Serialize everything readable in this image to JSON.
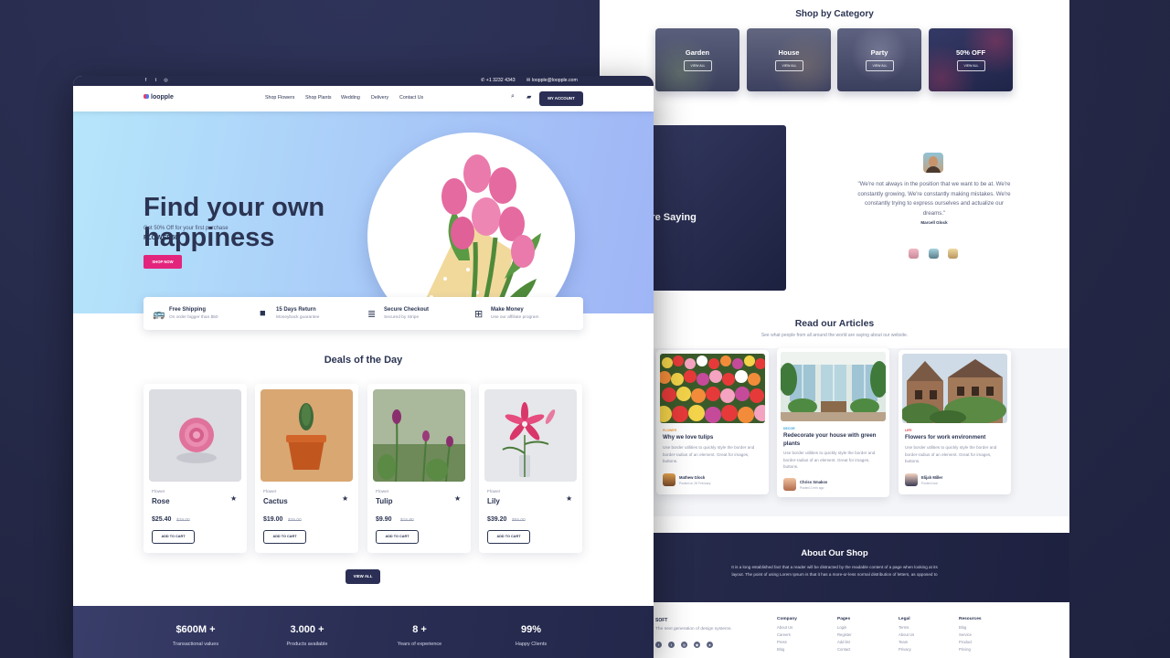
{
  "main": {
    "topbar": {
      "phone": "+1 3232 4343",
      "email": "loopple@loopple.com"
    },
    "nav": {
      "brand": "loopple",
      "links": [
        "Shop Flowers",
        "Shop Plants",
        "Wedding",
        "Delivery",
        "Contact Us"
      ],
      "account_label": "MY ACCOUNT"
    },
    "hero": {
      "title_line1": "Find your own",
      "title_line2": "happiness",
      "subtitle": "Get 50% Off for your first purchase",
      "code": "FLOWER50",
      "cta": "SHOP NOW"
    },
    "features": [
      {
        "title": "Free Shipping",
        "sub": "On order bigger than $50",
        "icon": "bus-icon"
      },
      {
        "title": "15 Days Return",
        "sub": "Moneyback guarantee",
        "icon": "briefcase-icon"
      },
      {
        "title": "Secure Checkout",
        "sub": "Secured by Stripe",
        "icon": "coins-icon"
      },
      {
        "title": "Make Money",
        "sub": "Use our affiliate program",
        "icon": "gift-icon"
      }
    ],
    "deals": {
      "title": "Deals of the Day",
      "cart_label": "ADD TO CART",
      "view_all": "VIEW ALL",
      "products": [
        {
          "category": "Flower",
          "name": "Rose",
          "price": "$25.40",
          "old_price": "$29.00"
        },
        {
          "category": "Flower",
          "name": "Cactus",
          "price": "$19.00",
          "old_price": "$25.00"
        },
        {
          "category": "Flower",
          "name": "Tulip",
          "price": "$9.90",
          "old_price": "$15.90"
        },
        {
          "category": "Flower",
          "name": "Lily",
          "price": "$39.20",
          "old_price": "$55.00"
        }
      ]
    },
    "stats": [
      {
        "value": "$600M +",
        "label": "Transactional values"
      },
      {
        "value": "3.000 +",
        "label": "Products available"
      },
      {
        "value": "8 +",
        "label": "Years of experience"
      },
      {
        "value": "99%",
        "label": "Happy Clients"
      }
    ]
  },
  "right": {
    "category": {
      "title": "Shop by Category",
      "btn": "VIEW ALL",
      "items": [
        "Garden",
        "House",
        "Party",
        "50% OFF"
      ]
    },
    "testimonials": {
      "title": "ur Clients Are Saying",
      "quote": "\"We're not always in the position that we want to be at. We're constantly growing. We're constantly making mistakes. We're constantly trying to express ourselves and actualize our dreams.\"",
      "author": "Marcell Glock"
    },
    "articles": {
      "title": "Read our Articles",
      "subtitle": "See what people from all around the world are saying about our website.",
      "items": [
        {
          "tag": "FLOWER",
          "title": "Why we love tulips",
          "text": "Use border utilities to quickly style the border and border-radius of an element. Great for images, buttons.",
          "author": "Mathew Glock",
          "date": "Posted on 28 February"
        },
        {
          "tag": "DECOR",
          "title": "Redecorate your house with green plants",
          "text": "Use border utilities to quickly style the border and border-radius of an element. Great for images, buttons.",
          "author": "Chriss Smakos",
          "date": "Posted 2 min ago"
        },
        {
          "tag": "LIFE",
          "title": "Flowers for work environment",
          "text": "Use border utilities to quickly style the border and border-radius of an element. Great for images, buttons.",
          "author": "Elijah Miller",
          "date": "Posted now"
        }
      ]
    },
    "about": {
      "title": "About Our Shop",
      "text": "It is a long established fact that a reader will be distracted by the readable content of a page when looking at its layout. The point of using Lorem Ipsum is that it has a more-or-less normal distribution of letters, as opposed to"
    },
    "footer": {
      "brand": "SOFT",
      "tagline": "The next generation of design systems.",
      "columns": [
        {
          "heading": "Company",
          "links": [
            "About Us",
            "Careers",
            "Press",
            "Blog"
          ]
        },
        {
          "heading": "Pages",
          "links": [
            "Login",
            "Register",
            "Add list",
            "Contact"
          ]
        },
        {
          "heading": "Legal",
          "links": [
            "Terms",
            "About Us",
            "Team",
            "Privacy"
          ]
        },
        {
          "heading": "Resources",
          "links": [
            "Blog",
            "Service",
            "Product",
            "Pricing"
          ]
        }
      ]
    }
  },
  "colors": {
    "navy": "#2b2f55",
    "accent_pink": "#e3247d",
    "text": "#2b3452"
  }
}
